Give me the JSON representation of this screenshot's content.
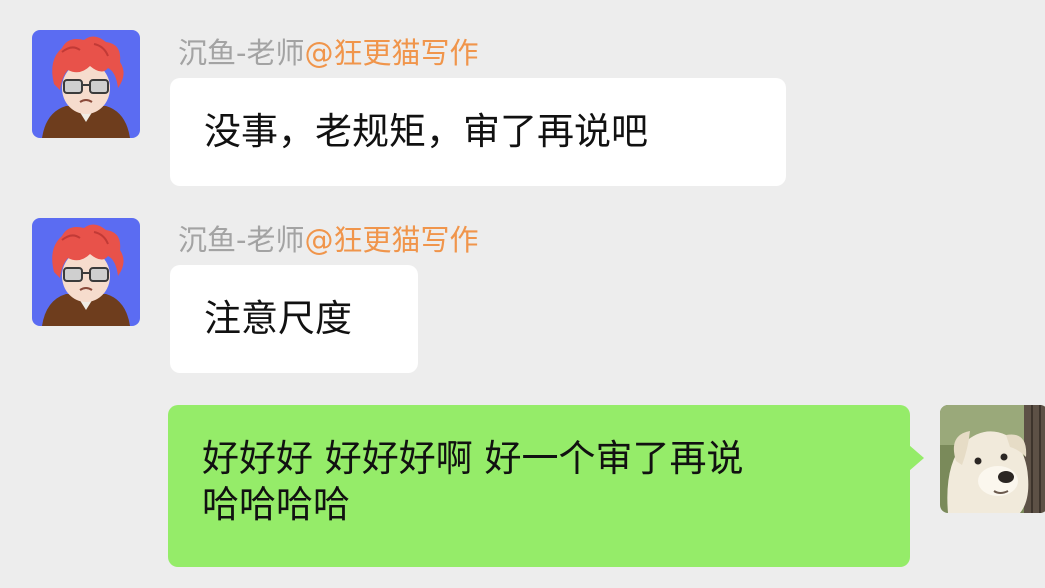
{
  "messages": [
    {
      "sender_name": "沉鱼-老师",
      "sender_mention": "@狂更猫写作",
      "text": "没事，老规矩，审了再说吧"
    },
    {
      "sender_name": "沉鱼-老师",
      "sender_mention": "@狂更猫写作",
      "text": "注意尺度"
    },
    {
      "text_line1": "好好好 好好好啊 好一个审了再说",
      "text_line2": "哈哈哈哈"
    }
  ],
  "colors": {
    "background": "#ededed",
    "incoming_bubble": "#ffffff",
    "outgoing_bubble": "#95ec69",
    "sender_name": "#a3a3a3",
    "mention": "#f0954b",
    "avatar_bg": "#5b6cf2"
  },
  "icons": {
    "teacher_avatar": "anime-red-hair-glasses-avatar",
    "my_avatar": "white-dog-photo-avatar"
  }
}
